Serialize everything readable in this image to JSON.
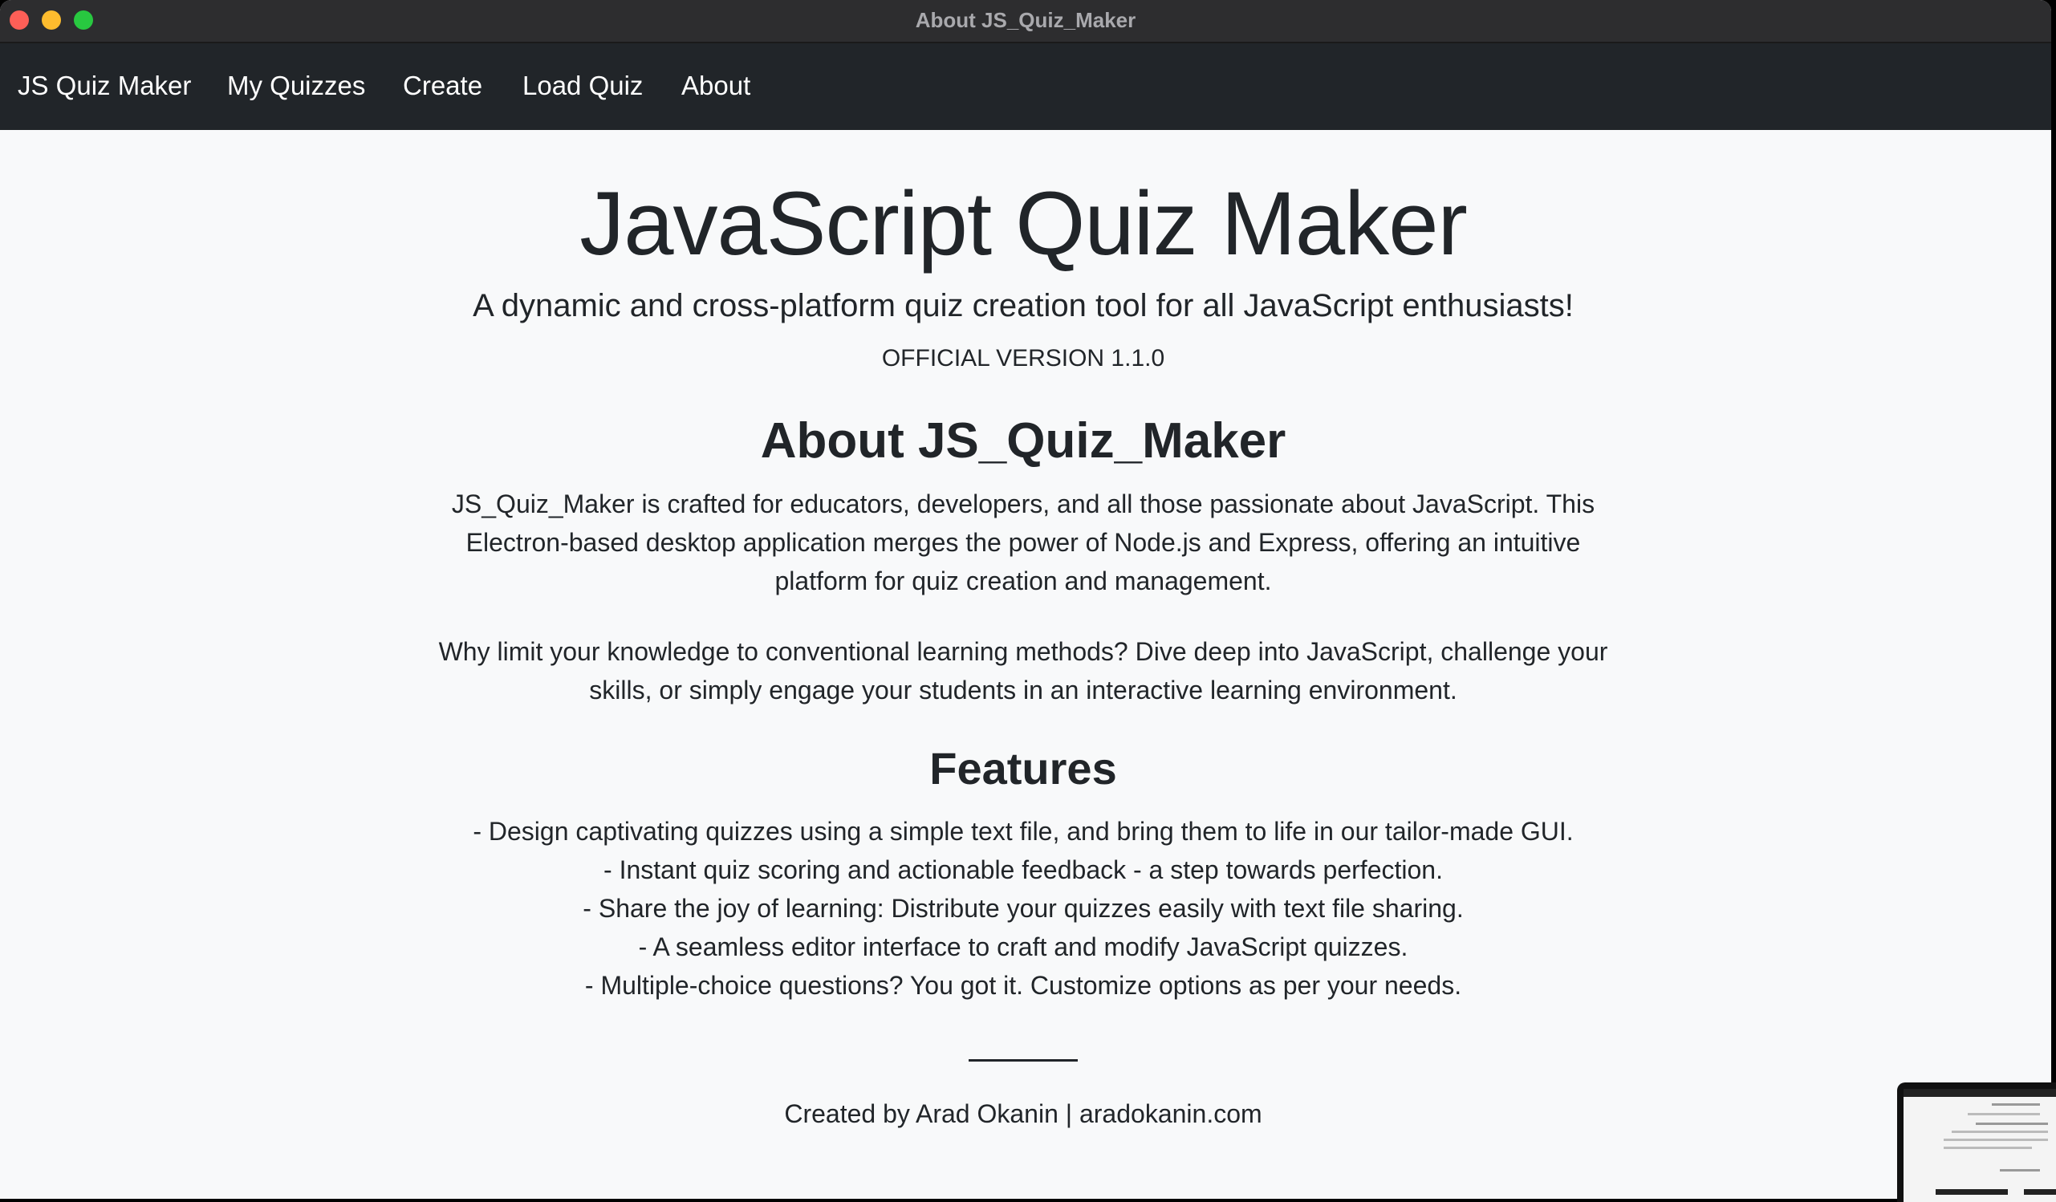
{
  "window": {
    "title": "About JS_Quiz_Maker"
  },
  "navbar": {
    "brand": "JS Quiz Maker",
    "items": [
      {
        "label": "My Quizzes"
      },
      {
        "label": "Create"
      },
      {
        "label": "Load Quiz"
      },
      {
        "label": "About"
      }
    ]
  },
  "hero": {
    "title": "JavaScript Quiz Maker",
    "lead": "A dynamic and cross-platform quiz creation tool for all JavaScript enthusiasts!",
    "version": "OFFICIAL VERSION 1.1.0"
  },
  "about": {
    "heading": "About JS_Quiz_Maker",
    "paragraph1": "JS_Quiz_Maker is crafted for educators, developers, and all those passionate about JavaScript. This Electron-based desktop application merges the power of Node.js and Express, offering an intuitive platform for quiz creation and management.",
    "paragraph2": "Why limit your knowledge to conventional learning methods? Dive deep into JavaScript, challenge your skills, or simply engage your students in an interactive learning environment."
  },
  "features": {
    "heading": "Features",
    "items": [
      "- Design captivating quizzes using a simple text file, and bring them to life in our tailor-made GUI.",
      "- Instant quiz scoring and actionable feedback - a step towards perfection.",
      "- Share the joy of learning: Distribute your quizzes easily with text file sharing.",
      "- A seamless editor interface to craft and modify JavaScript quizzes.",
      "- Multiple-choice questions? You got it. Customize options as per your needs."
    ]
  },
  "footer": {
    "credit": "Created by Arad Okanin | aradokanin.com"
  },
  "colors": {
    "navbar_bg": "#212529",
    "page_bg": "#f8f9fa",
    "text": "#212529",
    "traffic_close": "#fe5f57",
    "traffic_minimize": "#febc2e",
    "traffic_maximize": "#28c840"
  }
}
